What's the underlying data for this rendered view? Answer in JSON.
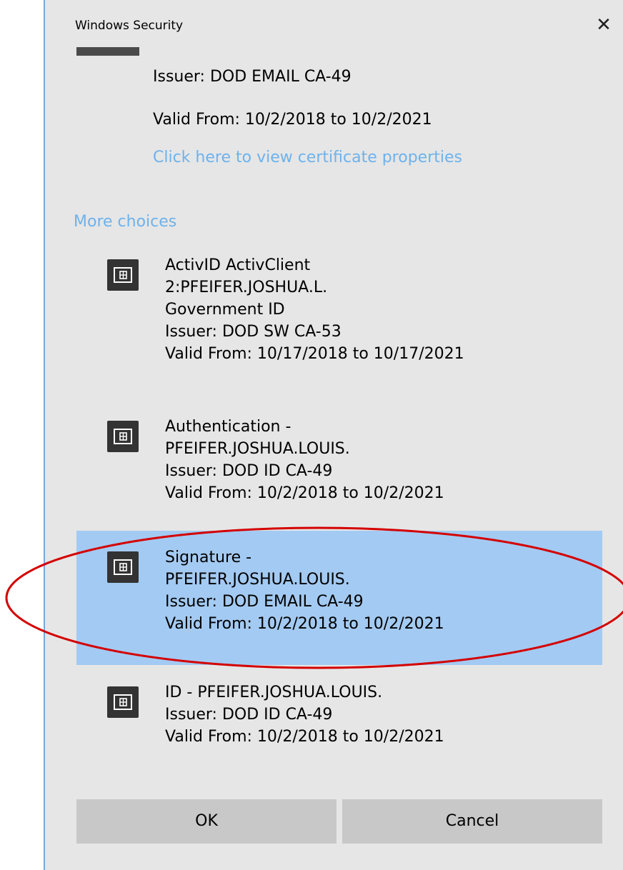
{
  "window": {
    "title": "Windows Security",
    "close_glyph": "✕"
  },
  "selected_cert": {
    "issuer": "Issuer: DOD EMAIL CA-49",
    "valid": "Valid From: 10/2/2018 to 10/2/2021",
    "view_link": "Click here to view certificate properties"
  },
  "more_choices": "More choices",
  "certificates": [
    {
      "lines": [
        "ActivID ActivClient",
        "2:PFEIFER.JOSHUA.L.",
        "Government ID",
        "Issuer: DOD SW CA-53",
        "Valid From: 10/17/2018 to 10/17/2021"
      ],
      "icon": "smart-card-icon",
      "selected": false
    },
    {
      "lines": [
        "Authentication -",
        "PFEIFER.JOSHUA.LOUIS.",
        "Issuer: DOD ID CA-49",
        "Valid From: 10/2/2018 to 10/2/2021"
      ],
      "icon": "smart-card-icon",
      "selected": false
    },
    {
      "lines": [
        "Signature -",
        "PFEIFER.JOSHUA.LOUIS.",
        "Issuer: DOD EMAIL CA-49",
        "Valid From: 10/2/2018 to 10/2/2021"
      ],
      "icon": "smart-card-icon",
      "selected": true
    },
    {
      "lines": [
        "ID - PFEIFER.JOSHUA.LOUIS.",
        "Issuer: DOD ID CA-49",
        "Valid From: 10/2/2018 to 10/2/2021"
      ],
      "icon": "smart-card-icon",
      "selected": false
    }
  ],
  "buttons": {
    "ok": "OK",
    "cancel": "Cancel"
  },
  "colors": {
    "dialog_bg": "#e6e6e6",
    "link": "#6eb2ec",
    "selection": "#a3caf2",
    "button": "#c8c8c8",
    "annotation": "#d40000"
  }
}
